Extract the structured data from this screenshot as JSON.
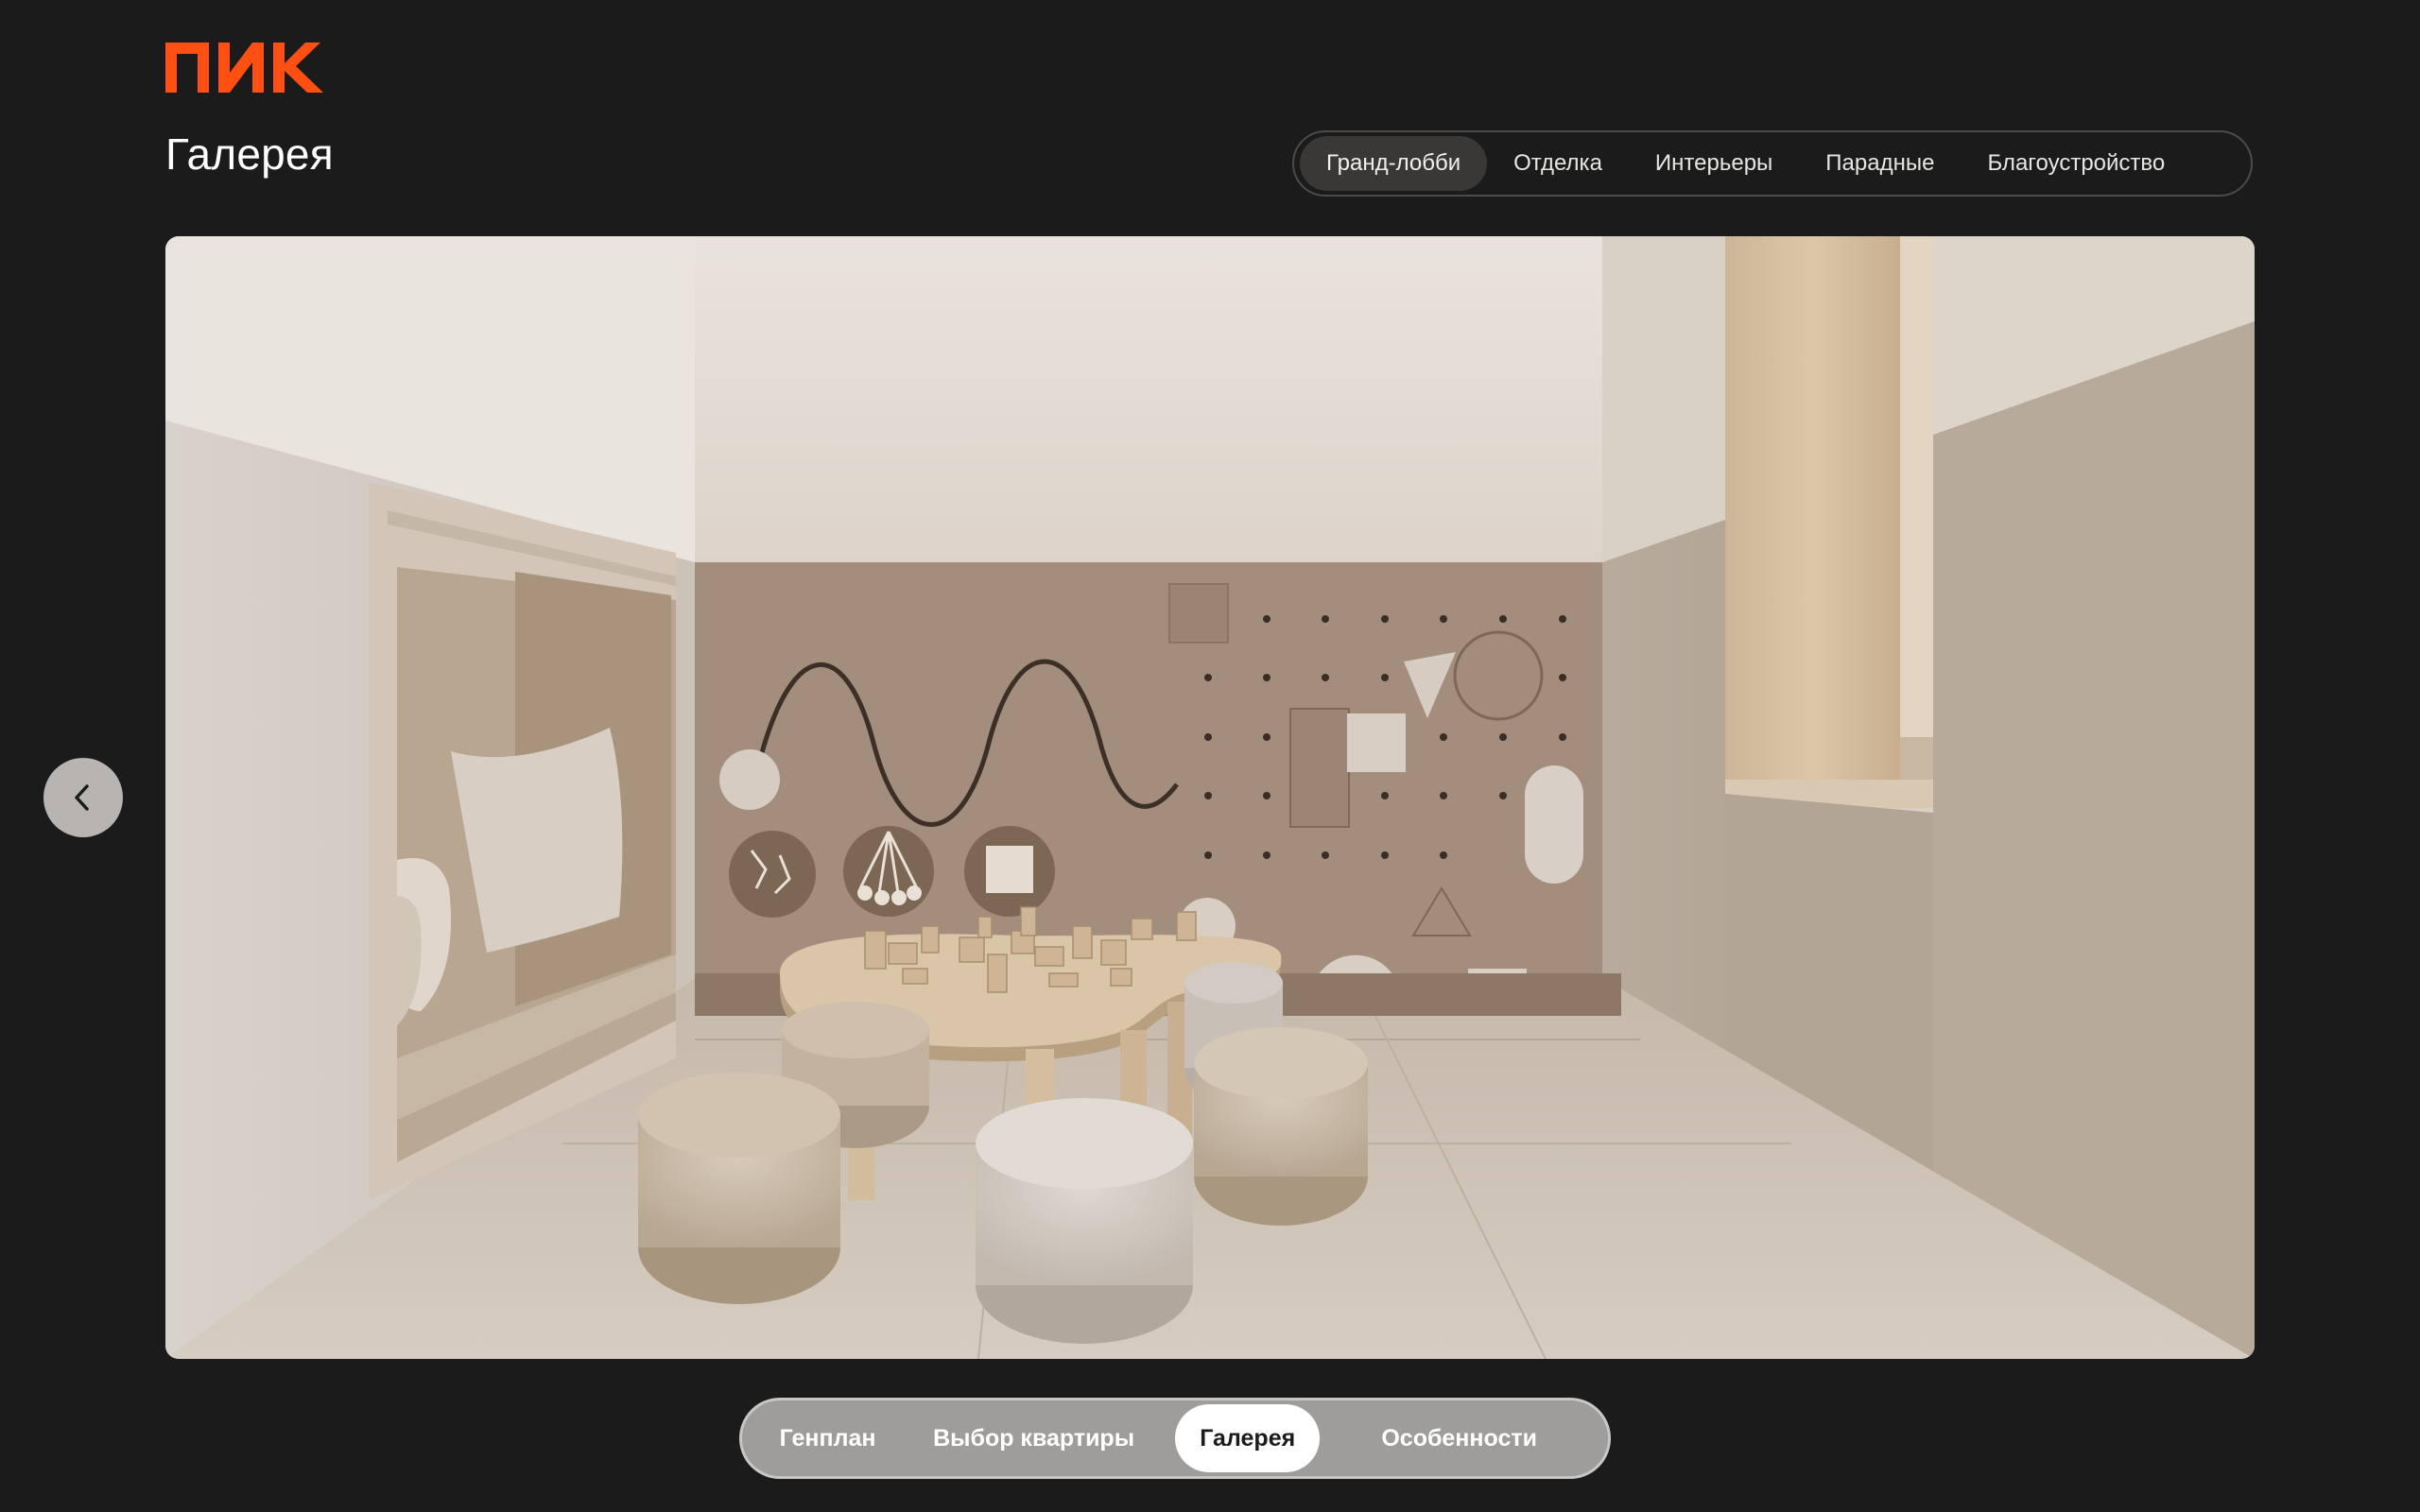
{
  "brand": {
    "logo_text": "ПИК",
    "accent": "#ff4f12"
  },
  "page": {
    "title": "Галерея"
  },
  "gallery_tabs": {
    "items": [
      "Гранд-лобби",
      "Отделка",
      "Интерьеры",
      "Парадные",
      "Благоустройство"
    ],
    "active_index": 0
  },
  "gallery": {
    "prev_icon": "chevron-left-icon"
  },
  "bottom_nav": {
    "items": [
      "Генплан",
      "Выбор квартиры",
      "Галерея",
      "Особенности"
    ],
    "active_index": 2
  }
}
